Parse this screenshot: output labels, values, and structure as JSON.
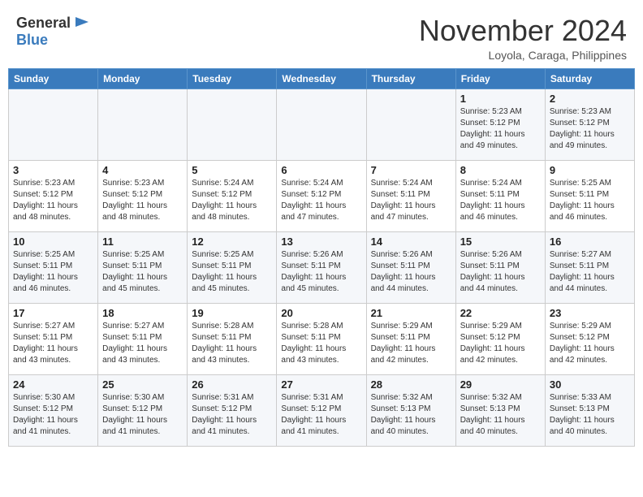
{
  "header": {
    "logo_general": "General",
    "logo_blue": "Blue",
    "month_title": "November 2024",
    "location": "Loyola, Caraga, Philippines"
  },
  "calendar": {
    "days_of_week": [
      "Sunday",
      "Monday",
      "Tuesday",
      "Wednesday",
      "Thursday",
      "Friday",
      "Saturday"
    ],
    "weeks": [
      [
        {
          "day": "",
          "info": ""
        },
        {
          "day": "",
          "info": ""
        },
        {
          "day": "",
          "info": ""
        },
        {
          "day": "",
          "info": ""
        },
        {
          "day": "",
          "info": ""
        },
        {
          "day": "1",
          "info": "Sunrise: 5:23 AM\nSunset: 5:12 PM\nDaylight: 11 hours\nand 49 minutes."
        },
        {
          "day": "2",
          "info": "Sunrise: 5:23 AM\nSunset: 5:12 PM\nDaylight: 11 hours\nand 49 minutes."
        }
      ],
      [
        {
          "day": "3",
          "info": "Sunrise: 5:23 AM\nSunset: 5:12 PM\nDaylight: 11 hours\nand 48 minutes."
        },
        {
          "day": "4",
          "info": "Sunrise: 5:23 AM\nSunset: 5:12 PM\nDaylight: 11 hours\nand 48 minutes."
        },
        {
          "day": "5",
          "info": "Sunrise: 5:24 AM\nSunset: 5:12 PM\nDaylight: 11 hours\nand 48 minutes."
        },
        {
          "day": "6",
          "info": "Sunrise: 5:24 AM\nSunset: 5:12 PM\nDaylight: 11 hours\nand 47 minutes."
        },
        {
          "day": "7",
          "info": "Sunrise: 5:24 AM\nSunset: 5:11 PM\nDaylight: 11 hours\nand 47 minutes."
        },
        {
          "day": "8",
          "info": "Sunrise: 5:24 AM\nSunset: 5:11 PM\nDaylight: 11 hours\nand 46 minutes."
        },
        {
          "day": "9",
          "info": "Sunrise: 5:25 AM\nSunset: 5:11 PM\nDaylight: 11 hours\nand 46 minutes."
        }
      ],
      [
        {
          "day": "10",
          "info": "Sunrise: 5:25 AM\nSunset: 5:11 PM\nDaylight: 11 hours\nand 46 minutes."
        },
        {
          "day": "11",
          "info": "Sunrise: 5:25 AM\nSunset: 5:11 PM\nDaylight: 11 hours\nand 45 minutes."
        },
        {
          "day": "12",
          "info": "Sunrise: 5:25 AM\nSunset: 5:11 PM\nDaylight: 11 hours\nand 45 minutes."
        },
        {
          "day": "13",
          "info": "Sunrise: 5:26 AM\nSunset: 5:11 PM\nDaylight: 11 hours\nand 45 minutes."
        },
        {
          "day": "14",
          "info": "Sunrise: 5:26 AM\nSunset: 5:11 PM\nDaylight: 11 hours\nand 44 minutes."
        },
        {
          "day": "15",
          "info": "Sunrise: 5:26 AM\nSunset: 5:11 PM\nDaylight: 11 hours\nand 44 minutes."
        },
        {
          "day": "16",
          "info": "Sunrise: 5:27 AM\nSunset: 5:11 PM\nDaylight: 11 hours\nand 44 minutes."
        }
      ],
      [
        {
          "day": "17",
          "info": "Sunrise: 5:27 AM\nSunset: 5:11 PM\nDaylight: 11 hours\nand 43 minutes."
        },
        {
          "day": "18",
          "info": "Sunrise: 5:27 AM\nSunset: 5:11 PM\nDaylight: 11 hours\nand 43 minutes."
        },
        {
          "day": "19",
          "info": "Sunrise: 5:28 AM\nSunset: 5:11 PM\nDaylight: 11 hours\nand 43 minutes."
        },
        {
          "day": "20",
          "info": "Sunrise: 5:28 AM\nSunset: 5:11 PM\nDaylight: 11 hours\nand 43 minutes."
        },
        {
          "day": "21",
          "info": "Sunrise: 5:29 AM\nSunset: 5:11 PM\nDaylight: 11 hours\nand 42 minutes."
        },
        {
          "day": "22",
          "info": "Sunrise: 5:29 AM\nSunset: 5:12 PM\nDaylight: 11 hours\nand 42 minutes."
        },
        {
          "day": "23",
          "info": "Sunrise: 5:29 AM\nSunset: 5:12 PM\nDaylight: 11 hours\nand 42 minutes."
        }
      ],
      [
        {
          "day": "24",
          "info": "Sunrise: 5:30 AM\nSunset: 5:12 PM\nDaylight: 11 hours\nand 41 minutes."
        },
        {
          "day": "25",
          "info": "Sunrise: 5:30 AM\nSunset: 5:12 PM\nDaylight: 11 hours\nand 41 minutes."
        },
        {
          "day": "26",
          "info": "Sunrise: 5:31 AM\nSunset: 5:12 PM\nDaylight: 11 hours\nand 41 minutes."
        },
        {
          "day": "27",
          "info": "Sunrise: 5:31 AM\nSunset: 5:12 PM\nDaylight: 11 hours\nand 41 minutes."
        },
        {
          "day": "28",
          "info": "Sunrise: 5:32 AM\nSunset: 5:13 PM\nDaylight: 11 hours\nand 40 minutes."
        },
        {
          "day": "29",
          "info": "Sunrise: 5:32 AM\nSunset: 5:13 PM\nDaylight: 11 hours\nand 40 minutes."
        },
        {
          "day": "30",
          "info": "Sunrise: 5:33 AM\nSunset: 5:13 PM\nDaylight: 11 hours\nand 40 minutes."
        }
      ]
    ]
  }
}
